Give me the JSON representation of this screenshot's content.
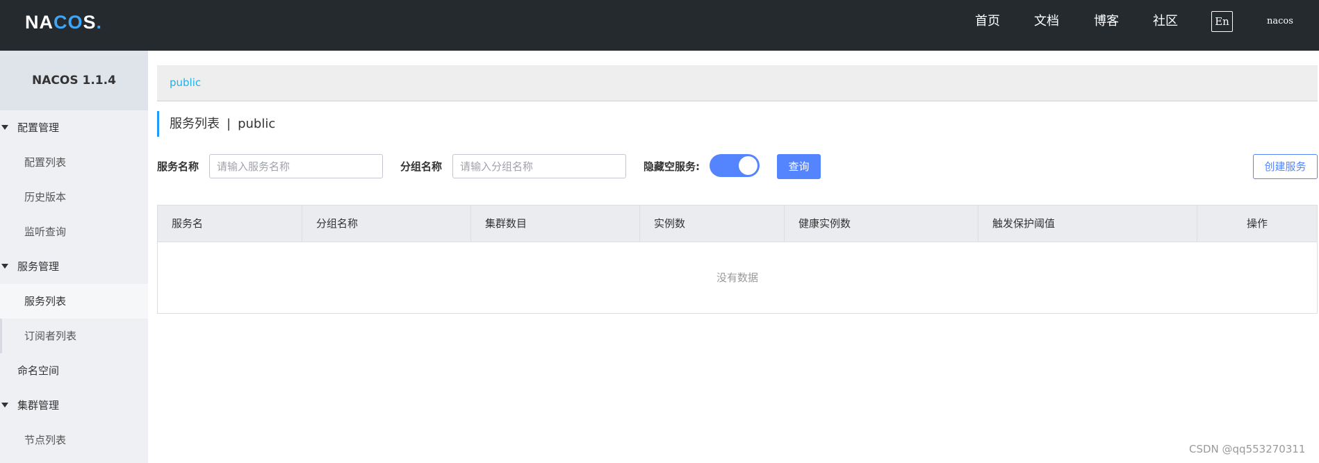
{
  "header": {
    "logo": {
      "pre": "NA",
      "c": "C",
      "o": "O",
      "post": "S",
      "dot": "."
    },
    "nav": [
      "首页",
      "文档",
      "博客",
      "社区"
    ],
    "lang_label": "En",
    "user": "nacos"
  },
  "sidebar": {
    "title": "NACOS 1.1.4",
    "groups": [
      {
        "label": "配置管理",
        "items": [
          "配置列表",
          "历史版本",
          "监听查询"
        ]
      },
      {
        "label": "服务管理",
        "items": [
          "服务列表",
          "订阅者列表"
        ]
      },
      {
        "label": "命名空间"
      },
      {
        "label": "集群管理",
        "items": [
          "节点列表"
        ]
      }
    ],
    "active_item": "服务列表"
  },
  "main": {
    "breadcrumb": "public",
    "title": "服务列表",
    "title_separator": "|",
    "title_namespace": "public",
    "filters": {
      "service_name_label": "服务名称",
      "service_name_placeholder": "请输入服务名称",
      "service_name_value": "",
      "group_name_label": "分组名称",
      "group_name_placeholder": "请输入分组名称",
      "group_name_value": "",
      "hide_empty_label": "隐藏空服务:",
      "hide_empty_on": true
    },
    "query_button": "查询",
    "create_button": "创建服务",
    "table": {
      "columns": [
        "服务名",
        "分组名称",
        "集群数目",
        "实例数",
        "健康实例数",
        "触发保护阈值",
        "操作"
      ],
      "rows": [],
      "empty_text": "没有数据"
    }
  },
  "watermark": "CSDN @qq553270311",
  "colors": {
    "header_bg": "#252a2f",
    "primary": "#5584ff",
    "link": "#21b0e8",
    "sidebar_bg": "#eef0f3"
  }
}
